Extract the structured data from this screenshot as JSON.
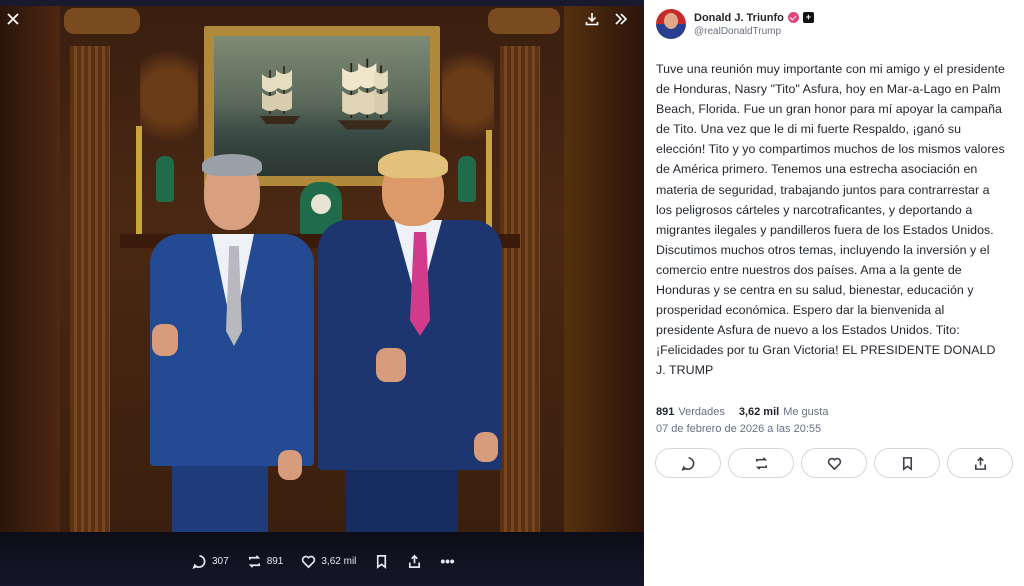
{
  "viewer": {
    "close_icon": "close-icon",
    "download_icon": "download-icon",
    "expand_icon": "expand-icon",
    "bar": {
      "replies": "307",
      "retruths": "891",
      "likes": "3,62 mil"
    }
  },
  "post": {
    "author_name": "Donald J. Triunfo",
    "author_handle": "@realDonaldTrump",
    "body": "Tuve una reunión muy importante con mi amigo y el presidente de Honduras, Nasry \"Tito\" Asfura, hoy en Mar-a-Lago en Palm Beach, Florida. Fue un gran honor para mí apoyar la campaña de Tito. Una vez que le di mi fuerte Respaldo, ¡ganó su elección! Tito y yo compartimos muchos de los mismos valores de América primero. Tenemos una estrecha asociación en materia de seguridad, trabajando juntos para contrarrestar a los peligrosos cárteles y narcotraficantes, y deportando a migrantes ilegales y pandilleros fuera de los Estados Unidos. Discutimos muchos otros temas, incluyendo la inversión y el comercio entre nuestros dos países. Ama a la gente de Honduras y se centra en su salud, bienestar, educación y prosperidad económica. Espero dar la bienvenida al presidente Asfura de nuevo a los Estados Unidos. Tito: ¡Felicidades por tu Gran Victoria! EL PRESIDENTE DONALD J. TRUMP",
    "stats": {
      "verdades_count": "891",
      "verdades_label": "Verdades",
      "likes_count": "3,62 mil",
      "likes_label": "Me gusta"
    },
    "date": "07 de febrero de 2026 a las 20:55"
  },
  "colors": {
    "verified_badge": "#e0457b",
    "viewer_bg": "#0b0b14",
    "panel_bg": "#ffffff"
  }
}
